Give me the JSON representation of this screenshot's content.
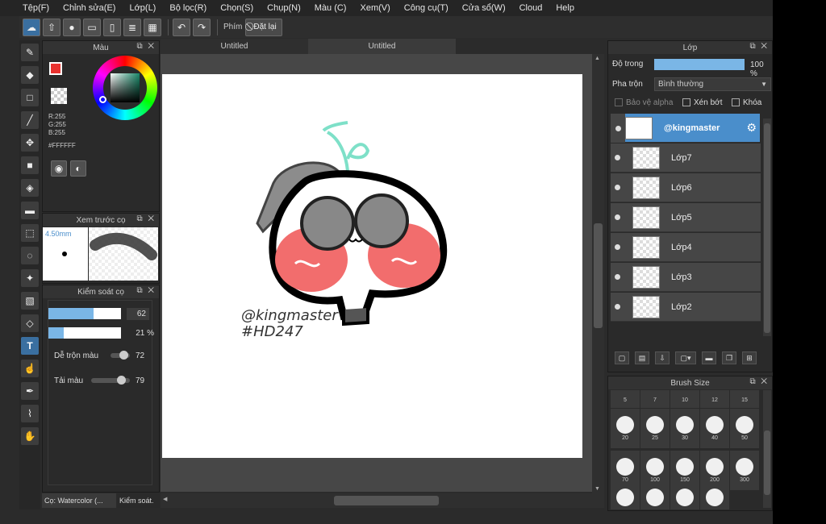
{
  "menu": [
    "Tệp(F)",
    "Chỉnh sửa(E)",
    "Lớp(L)",
    "Bộ lọc(R)",
    "Chọn(S)",
    "Chụp(N)",
    "Màu (C)",
    "Xem(V)",
    "Công cụ(T)",
    "Cửa sổ(W)",
    "Cloud",
    "Help"
  ],
  "toolbar": {
    "shortcut_label": "Phím",
    "reset_label": "Đặt lại"
  },
  "color_panel": {
    "title": "Màu",
    "r": "R:255",
    "g": "G:255",
    "b": "B:255",
    "hex": "#FFFFFF",
    "fg": "#e8322f",
    "bg": "#f08a85"
  },
  "brush_preview": {
    "title": "Xem trước cọ",
    "size": "4.50mm"
  },
  "brush_control": {
    "title": "Kiểm soát cọ",
    "size_value": "62",
    "opacity_value": "21 %",
    "size_fill": 0.62,
    "opacity_fill": 0.21,
    "blend_label": "Dễ trộn màu",
    "blend_value": "72",
    "blend_fill": 0.72,
    "color_label": "Tải màu",
    "color_value": "79",
    "color_fill": 0.79
  },
  "bottom_tabs": {
    "brush": "Cọ: Watercolor (...",
    "control": "Kiểm soát."
  },
  "tabs": [
    "Untitled",
    "Untitled"
  ],
  "artwork": {
    "line1": "@kingmaster",
    "line2": "#HD247"
  },
  "layers_panel": {
    "title": "Lớp",
    "opacity_label": "Độ trong",
    "opacity_value": "100 %",
    "opacity_fill": 1.0,
    "blend_label": "Pha trộn",
    "blend_value": "Bình thường",
    "alpha_label": "Bảo vệ alpha",
    "clip_label": "Xén bớt",
    "lock_label": "Khóa"
  },
  "layers": [
    {
      "name": "@kingmaster",
      "selected": true
    },
    {
      "name": "Lớp7"
    },
    {
      "name": "Lớp6"
    },
    {
      "name": "Lớp5"
    },
    {
      "name": "Lớp4"
    },
    {
      "name": "Lớp3"
    },
    {
      "name": "Lớp2"
    }
  ],
  "brush_size": {
    "title": "Brush Size",
    "row0": [
      "5",
      "7",
      "10",
      "12",
      "15"
    ],
    "row1": [
      "20",
      "25",
      "30",
      "40",
      "50"
    ],
    "row2": [
      "70",
      "100",
      "150",
      "200",
      "300"
    ]
  },
  "accent": "#4a8ecb"
}
